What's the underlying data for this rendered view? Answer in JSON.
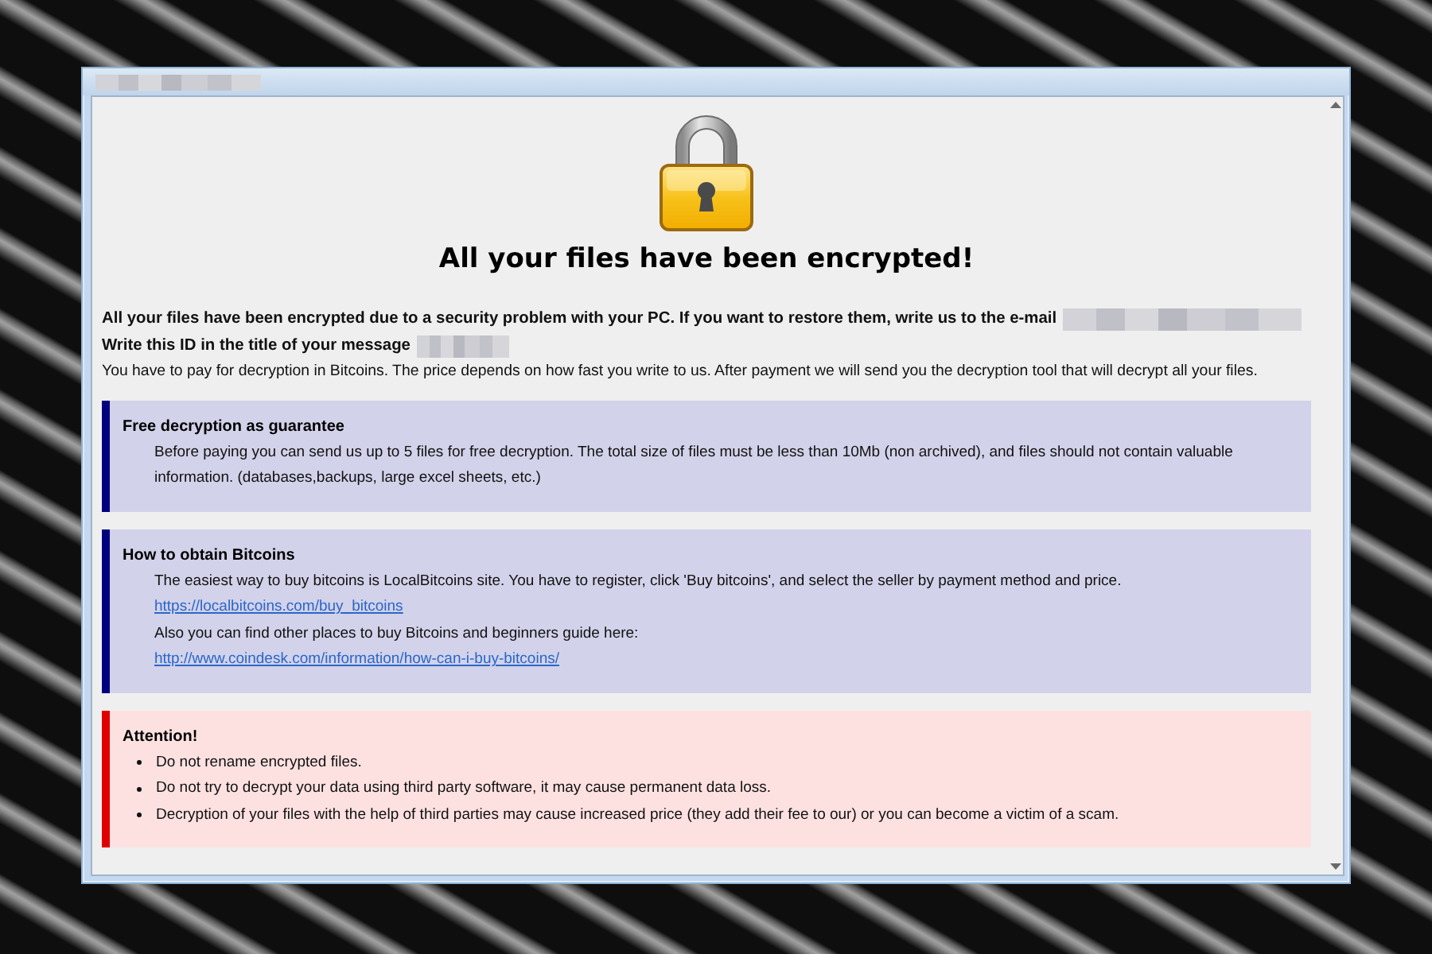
{
  "heading": "All your files have been encrypted!",
  "intro": [
    {
      "text": "All your files have been encrypted due to a security problem with your PC. If you want to restore them, write us to the e-mail",
      "bold": true,
      "redacted_after": true
    },
    {
      "text": "Write this ID in the title of your message",
      "bold": true,
      "redacted_after": true
    },
    {
      "text": "You have to pay for decryption in Bitcoins. The price depends on how fast you write to us. After payment we will send you the decryption tool that will decrypt all your files.",
      "bold": false,
      "redacted_after": false
    }
  ],
  "sections": [
    {
      "kind": "info",
      "title": "Free decryption as guarantee",
      "items": [
        {
          "kind": "paragraph",
          "text": "Before paying you can send us up to 5 files for free decryption. The total size of files must be less than 10Mb (non archived), and files should not contain valuable information. (databases,backups, large excel sheets, etc.)"
        }
      ]
    },
    {
      "kind": "info",
      "title": "How to obtain Bitcoins",
      "items": [
        {
          "kind": "paragraph",
          "text": "The easiest way to buy bitcoins is LocalBitcoins site. You have to register, click 'Buy bitcoins', and select the seller by payment method and price."
        },
        {
          "kind": "link",
          "text": "https://localbitcoins.com/buy_bitcoins"
        },
        {
          "kind": "paragraph",
          "text": "Also you can find other places to buy Bitcoins and beginners guide here:"
        },
        {
          "kind": "link",
          "text": "http://www.coindesk.com/information/how-can-i-buy-bitcoins/"
        }
      ]
    },
    {
      "kind": "warning",
      "title": "Attention!",
      "items": [
        {
          "kind": "bullet",
          "text": "Do not rename encrypted files."
        },
        {
          "kind": "bullet",
          "text": "Do not try to decrypt your data using third party software, it may cause permanent data loss."
        },
        {
          "kind": "bullet",
          "text": "Decryption of your files with the help of third parties may cause increased price (they add their fee to our) or you can become a victim of a scam."
        }
      ]
    }
  ]
}
